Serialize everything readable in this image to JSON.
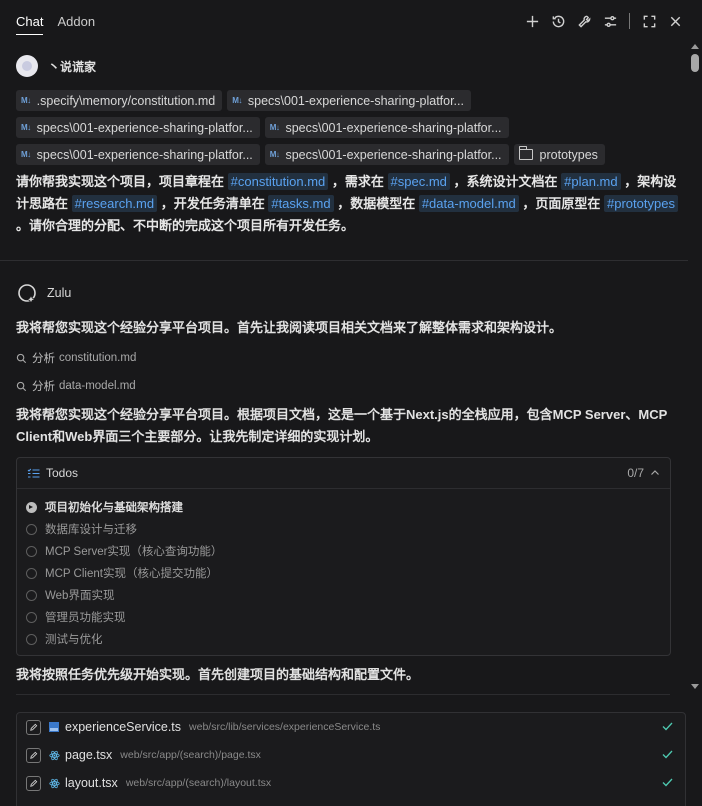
{
  "tabs": [
    {
      "label": "Chat",
      "active": true
    },
    {
      "label": "Addon",
      "active": false
    }
  ],
  "toolbar_icons": [
    "plus-icon",
    "history-icon",
    "wrench-icon",
    "settings-sliders-icon",
    "expand-icon",
    "close-icon"
  ],
  "user": {
    "name": "丶说谎家"
  },
  "attachments": {
    "rows": [
      [
        {
          "label": ".specify\\memory/constitution.md",
          "icon": "markdown-icon"
        },
        {
          "label": "specs\\001-experience-sharing-platfor...",
          "icon": "markdown-icon"
        }
      ],
      [
        {
          "label": "specs\\001-experience-sharing-platfor...",
          "icon": "markdown-icon"
        },
        {
          "label": "specs\\001-experience-sharing-platfor...",
          "icon": "markdown-icon"
        }
      ],
      [
        {
          "label": "specs\\001-experience-sharing-platfor...",
          "icon": "markdown-icon"
        },
        {
          "label": "specs\\001-experience-sharing-platfor...",
          "icon": "markdown-icon"
        },
        {
          "label": "prototypes",
          "icon": "folder-icon"
        }
      ]
    ]
  },
  "prompt": {
    "t1": "请你帮我实现这个项目，项目章程在 ",
    "r1": "#constitution.md",
    "t2": " ，需求在 ",
    "r2": "#spec.md",
    "t3": " ，系统设计文档在 ",
    "r3": "#plan.md",
    "t4": " ，架构设计思路在 ",
    "r4": "#research.md",
    "t5": " ，开发任务清单在 ",
    "r5": "#tasks.md",
    "t6": " ，数据模型在 ",
    "r6": "#data-model.md",
    "t7": " ，页面原型在 ",
    "r7": "#prototypes",
    "t8": " 。请你合理的分配、不中断的完成这个项目所有开发任务。"
  },
  "assistant": {
    "name": "Zulu",
    "intro": "我将帮您实现这个经验分享平台项目。首先让我阅读项目相关文档来了解整体需求和架构设计。",
    "analyze": [
      {
        "verb": "分析",
        "file": "constitution.md"
      },
      {
        "verb": "分析",
        "file": "data-model.md"
      }
    ],
    "summary": "我将帮您实现这个经验分享平台项目。根据项目文档，这是一个基于Next.js的全栈应用，包含MCP Server、MCP Client和Web界面三个主要部分。让我先制定详细的实现计划。",
    "next": "我将按照任务优先级开始实现。首先创建项目的基础结构和配置文件。"
  },
  "todos": {
    "title": "Todos",
    "count": "0/7",
    "items": [
      {
        "label": "项目初始化与基础架构搭建",
        "status": "in-progress"
      },
      {
        "label": "数据库设计与迁移",
        "status": "pending"
      },
      {
        "label": "MCP Server实现（核心查询功能）",
        "status": "pending"
      },
      {
        "label": "MCP Client实现（核心提交功能）",
        "status": "pending"
      },
      {
        "label": "Web界面实现",
        "status": "pending"
      },
      {
        "label": "管理员功能实现",
        "status": "pending"
      },
      {
        "label": "测试与优化",
        "status": "pending"
      }
    ]
  },
  "files": [
    {
      "name": "experienceService.ts",
      "path": "web/src/lib/services/experienceService.ts",
      "icon": "typescript-icon"
    },
    {
      "name": "page.tsx",
      "path": "web/src/app/(search)/page.tsx",
      "icon": "react-icon"
    },
    {
      "name": "layout.tsx",
      "path": "web/src/app/(search)/layout.tsx",
      "icon": "react-icon"
    }
  ],
  "colors": {
    "background": "#18181a",
    "link": "#5aa2f0",
    "check": "#4ec9b0"
  }
}
